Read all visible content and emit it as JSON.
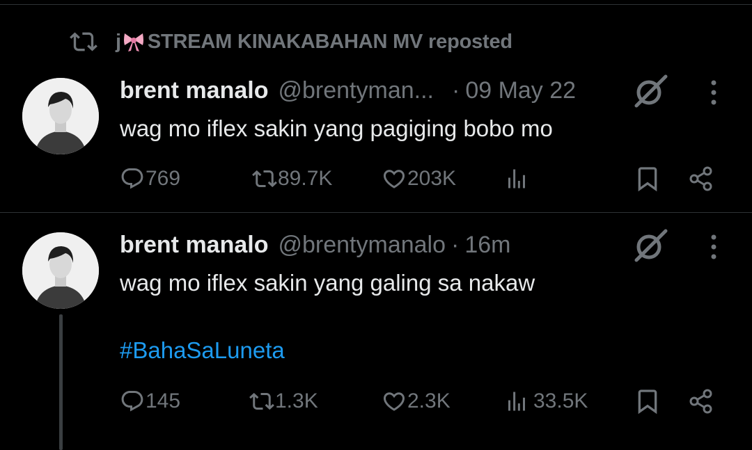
{
  "repost": {
    "prefix": "j",
    "name": "STREAM KINAKABAHAN MV reposted"
  },
  "tweets": [
    {
      "name": "brent manalo",
      "handle": "@brentyman...",
      "separator": "·",
      "time": "09 May 22",
      "text": "wag mo iflex sakin yang pagiging bobo mo",
      "hashtag": "",
      "replies": "769",
      "reposts": "89.7K",
      "likes": "203K",
      "views": ""
    },
    {
      "name": "brent manalo",
      "handle": "@brentymanalo",
      "separator": "·",
      "time": "16m",
      "text": "wag mo iflex sakin yang galing sa nakaw",
      "hashtag": "#BahaSaLuneta",
      "replies": "145",
      "reposts": "1.3K",
      "likes": "2.3K",
      "views": "33.5K"
    }
  ],
  "colors": {
    "background": "#000000",
    "text": "#e7e9ea",
    "muted": "#71767b",
    "link": "#1d9bf0",
    "divider": "#2f3336"
  },
  "icons": [
    "repost-icon",
    "bow-emoji-icon",
    "grok-icon",
    "more-icon",
    "reply-icon",
    "like-icon",
    "views-icon",
    "bookmark-icon",
    "share-icon"
  ]
}
